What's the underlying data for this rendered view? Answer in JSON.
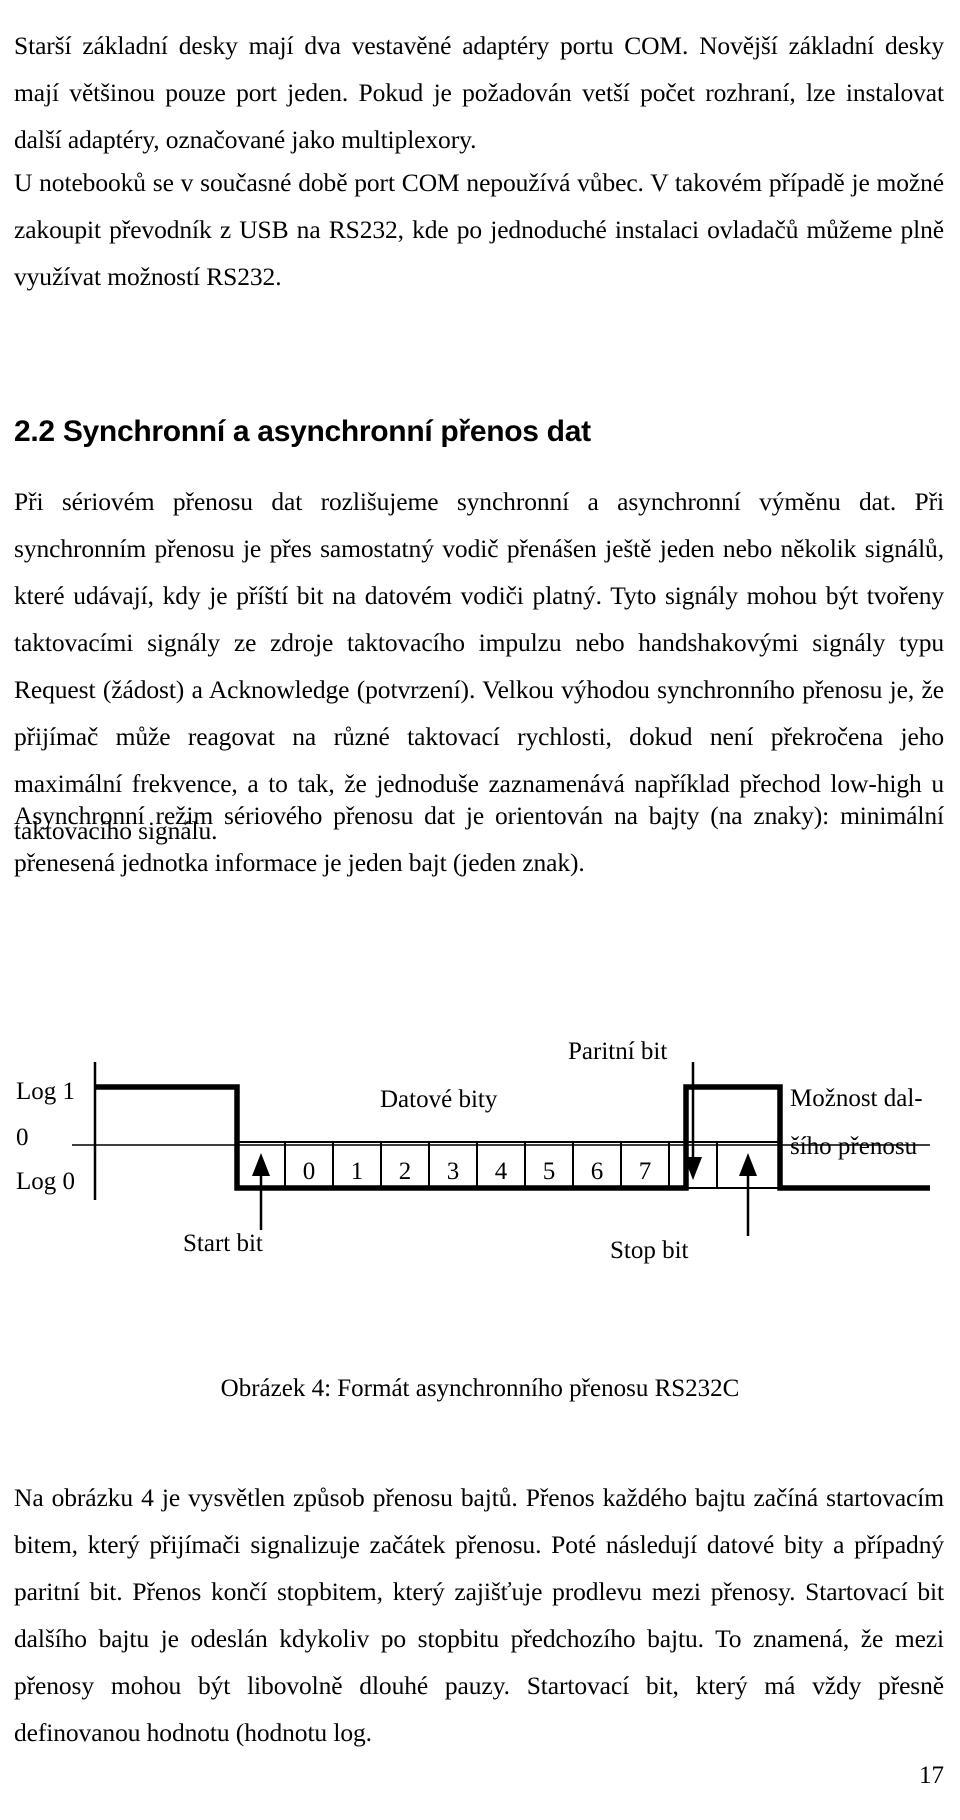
{
  "document": {
    "page_number": "17",
    "paragraphs": {
      "p1": "Starší základní desky mají dva vestavěné adaptéry portu COM. Novější základní desky mají většinou pouze port jeden. Pokud je požadován vetší počet rozhraní, lze instalovat další adaptéry, označované jako multiplexory.",
      "p2": "U notebooků se v současné době port COM nepoužívá vůbec. V takovém případě je možné zakoupit převodník z USB na RS232, kde po jednoduché instalaci ovladačů můžeme plně využívat možností RS232.",
      "p3": "Při sériovém přenosu dat rozlišujeme synchronní a asynchronní výměnu dat. Při synchronním přenosu je přes samostatný vodič přenášen ještě jeden nebo několik signálů, které udávají, kdy je příští bit na datovém vodiči platný. Tyto signály mohou být tvořeny taktovacími signály ze zdroje taktovacího impulzu nebo handshakovými signály typu Request (žádost) a Acknowledge (potvrzení). Velkou výhodou synchronního přenosu je, že přijímač může reagovat na různé taktovací rychlosti, dokud není překročena jeho maximální frekvence, a to tak, že jednoduše zaznamenává například přechod low-high u taktovacího signálu.",
      "p4": "Asynchronní režim sériového přenosu dat je orientován na bajty (na znaky): minimální přenesená jednotka informace je jeden bajt (jeden znak).",
      "p5": "Na obrázku 4 je vysvětlen způsob přenosu bajtů. Přenos každého bajtu začíná startovacím bitem, který přijímači signalizuje začátek přenosu. Poté následují datové bity a případný paritní bit. Přenos končí stopbitem, který zajišťuje prodlevu mezi přenosy. Startovací bit dalšího bajtu je odeslán kdykoliv po stopbitu předchozího bajtu. To znamená, že mezi přenosy mohou být libovolně dlouhé pauzy. Startovací bit, který má vždy přesně definovanou hodnotu (hodnotu log."
    },
    "heading": {
      "number": "2.2",
      "text": "2.2 Synchronní a asynchronní přenos dat"
    },
    "figure": {
      "caption": "Obrázek 4: Formát asynchronního přenosu RS232C",
      "axis_labels": {
        "high": "Log 1",
        "zero": "0",
        "low": "Log 0"
      },
      "annotations": {
        "data_bits": "Datové bity",
        "parity_bit": "Paritní bit",
        "next_line1": "Možnost dal-",
        "next_line2": "šího přenosu",
        "start_bit": "Start bit",
        "stop_bit": "Stop bit"
      },
      "data_bit_cells": [
        "0",
        "1",
        "2",
        "3",
        "4",
        "5",
        "6",
        "7"
      ],
      "colors": {
        "signal": "#000000",
        "axis": "#000000",
        "background": "#ffffff"
      }
    }
  }
}
